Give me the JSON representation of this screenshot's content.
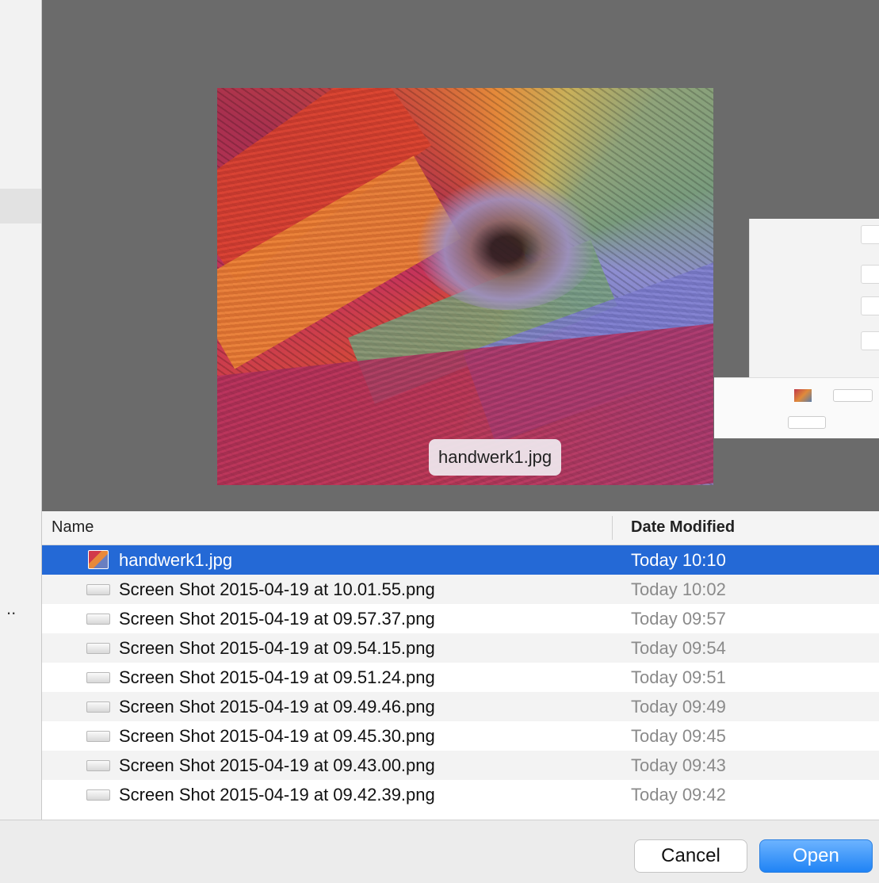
{
  "preview": {
    "file_label": "handwerk1.jpg"
  },
  "list": {
    "headers": {
      "name": "Name",
      "date_modified": "Date Modified"
    },
    "rows": [
      {
        "name": "handwerk1.jpg",
        "date": "Today 10:10",
        "selected": true,
        "icon": "image-file-icon"
      },
      {
        "name": "Screen Shot 2015-04-19 at 10.01.55.png",
        "date": "Today 10:02",
        "selected": false,
        "icon": "screenshot-file-icon"
      },
      {
        "name": "Screen Shot 2015-04-19 at 09.57.37.png",
        "date": "Today 09:57",
        "selected": false,
        "icon": "screenshot-file-icon"
      },
      {
        "name": "Screen Shot 2015-04-19 at 09.54.15.png",
        "date": "Today 09:54",
        "selected": false,
        "icon": "screenshot-file-icon"
      },
      {
        "name": "Screen Shot 2015-04-19 at 09.51.24.png",
        "date": "Today 09:51",
        "selected": false,
        "icon": "screenshot-file-icon"
      },
      {
        "name": "Screen Shot 2015-04-19 at 09.49.46.png",
        "date": "Today 09:49",
        "selected": false,
        "icon": "screenshot-file-icon"
      },
      {
        "name": "Screen Shot 2015-04-19 at 09.45.30.png",
        "date": "Today 09:45",
        "selected": false,
        "icon": "screenshot-file-icon"
      },
      {
        "name": "Screen Shot 2015-04-19 at 09.43.00.png",
        "date": "Today 09:43",
        "selected": false,
        "icon": "screenshot-file-icon"
      },
      {
        "name": "Screen Shot 2015-04-19 at 09.42.39.png",
        "date": "Today 09:42",
        "selected": false,
        "icon": "screenshot-file-icon"
      }
    ]
  },
  "footer": {
    "cancel_label": "Cancel",
    "open_label": "Open"
  },
  "sidebar": {
    "overflow_marker": ".."
  },
  "colors": {
    "selection": "#2469d6",
    "primary_button": "#1f83f5",
    "preview_background": "#6b6b6b"
  }
}
